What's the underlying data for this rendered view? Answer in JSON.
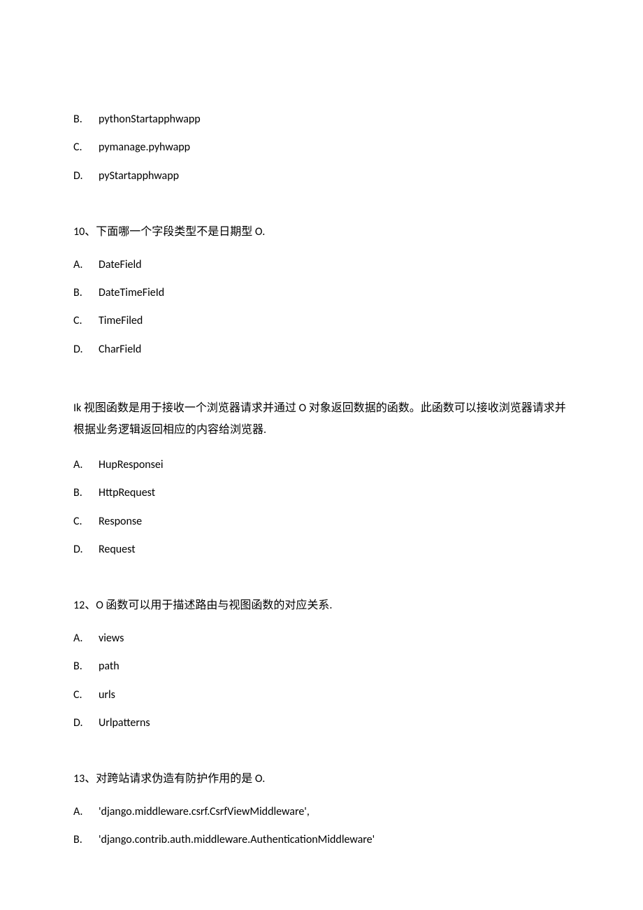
{
  "prev_options": {
    "b": {
      "label": "B.",
      "text": "pythonStartapphwapp"
    },
    "c": {
      "label": "C.",
      "text": "pymanage.pyhwapp"
    },
    "d": {
      "label": "D.",
      "text": "pyStartapphwapp"
    }
  },
  "q10": {
    "prompt": "10、下面哪一个字段类型不是日期型 O.",
    "a": {
      "label": "A.",
      "text": "DateField"
    },
    "b": {
      "label": "B.",
      "text": "DateTimeFieId"
    },
    "c": {
      "label": "C.",
      "text": "TimeFiled"
    },
    "d": {
      "label": "D.",
      "text": "CharField"
    }
  },
  "q11": {
    "prompt": "Ik 视图函数是用于接收一个浏览器请求并通过 O 对象返回数据的函数。此函数可以接收浏览器请求并根据业务逻辑返回相应的内容给浏览器.",
    "a": {
      "label": "A.",
      "text": "HupResponsei"
    },
    "b": {
      "label": "B.",
      "text": "HttpRequest"
    },
    "c": {
      "label": "C.",
      "text": "Response"
    },
    "d": {
      "label": "D.",
      "text": "Request"
    }
  },
  "q12": {
    "prompt": "12、O 函数可以用于描述路由与视图函数的对应关系.",
    "a": {
      "label": "A.",
      "text": "views"
    },
    "b": {
      "label": "B.",
      "text": "path"
    },
    "c": {
      "label": "C.",
      "text": "urls"
    },
    "d": {
      "label": "D.",
      "text": "Urlpatterns"
    }
  },
  "q13": {
    "prompt": "13、对跨站请求伪造有防护作用的是 O.",
    "a": {
      "label": "A.",
      "text": "'django.middleware.csrf.CsrfViewMiddleware',"
    },
    "b": {
      "label": "B.",
      "text": "'django.contrib.auth.middleware.AuthenticationMiddleware'"
    }
  }
}
